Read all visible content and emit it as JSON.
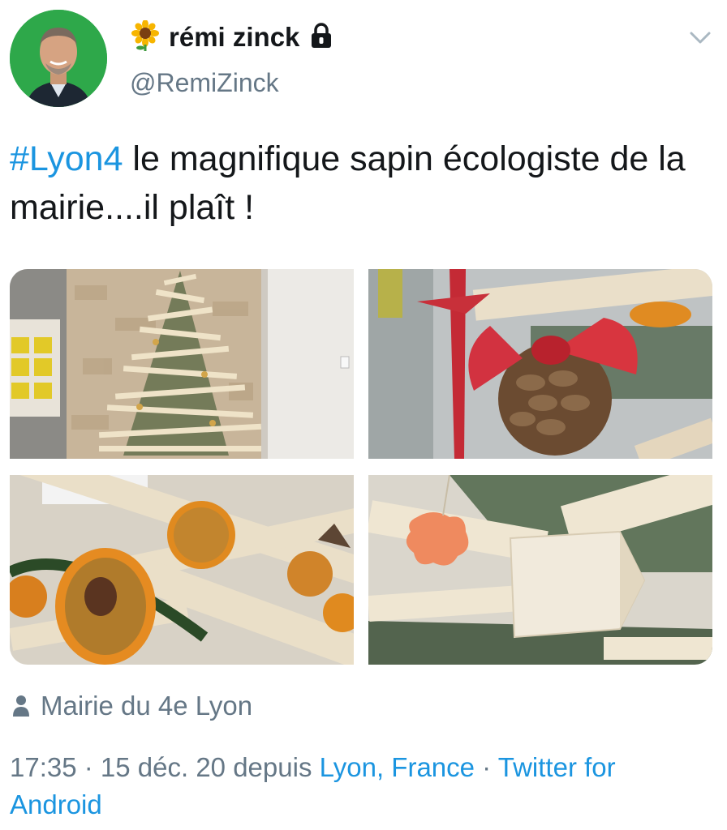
{
  "author": {
    "emoji": "🌻",
    "name": "rémi zinck",
    "handle": "@RemiZinck",
    "lock_icon": "lock-icon",
    "avatar_bg": "#2ea84a"
  },
  "tweet": {
    "hashtag": "#Lyon4",
    "text": " le magnifique sapin écologiste de la mairie....il plaît !"
  },
  "photos": [
    {
      "name": "tree-photo"
    },
    {
      "name": "pinecone-bow-photo"
    },
    {
      "name": "dried-orange-photo"
    },
    {
      "name": "ornament-photo"
    }
  ],
  "location": {
    "icon": "person-icon",
    "label": "Mairie du 4e Lyon"
  },
  "meta": {
    "time_date": "17:35 · 15 déc. 20 depuis ",
    "place": "Lyon, France",
    "separator": " · ",
    "source": "Twitter for Android"
  },
  "colors": {
    "link": "#1b95e0",
    "secondary": "#657786",
    "primary_text": "#14171a"
  }
}
